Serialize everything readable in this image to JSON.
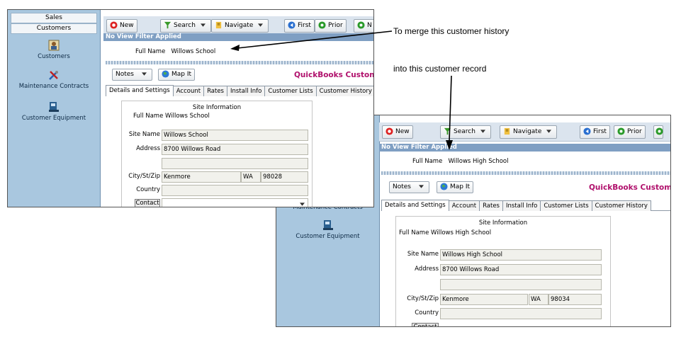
{
  "sidebar": {
    "nav_buttons": [
      "Sales",
      "Customers"
    ],
    "items": [
      {
        "label": "Customers",
        "icon": "customer-icon"
      },
      {
        "label": "Maintenance Contracts",
        "icon": "tools-icon"
      },
      {
        "label": "Customer Equipment",
        "icon": "equipment-icon"
      }
    ]
  },
  "toolbar": {
    "new_label": "New",
    "search_label": "Search",
    "navigate_label": "Navigate",
    "first_label": "First",
    "prior_label": "Prior",
    "cut_next_label_1": "N"
  },
  "filter_text": "No View Filter Applied",
  "subbar": {
    "notes_label": "Notes",
    "map_label": "Map It",
    "qb_title_1": "QuickBooks Customer",
    "qb_title_2": "QuickBooks Custome"
  },
  "tabs": [
    "Details and Settings",
    "Account",
    "Rates",
    "Install Info",
    "Customer Lists",
    "Customer History"
  ],
  "form_labels": {
    "site_information": "Site Information",
    "full_name": "Full Name",
    "site_name": "Site Name",
    "address": "Address",
    "city_st_zip": "City/St/Zip",
    "country": "Country",
    "contact": "Contact"
  },
  "record1": {
    "full_name": "Willows School",
    "site_name": "Willows School",
    "address": "8700 Willows Road",
    "city": "Kenmore",
    "state": "WA",
    "zip": "98028"
  },
  "record2": {
    "full_name": "Willows High School",
    "site_name": "Willows High School",
    "address": "8700 Willows Road",
    "city": "Kenmore",
    "state": "WA",
    "zip": "98034",
    "partial_sidebar_label": "Maintenance Contracts",
    "equipment_label": "Customer Equipment"
  },
  "annotations": {
    "merge_from": "To merge this customer history",
    "merge_into": "into this customer record"
  },
  "colors": {
    "sidebar": "#a9c7df",
    "filter_bar": "#7f9fc3",
    "qb_title": "#b0106c"
  }
}
